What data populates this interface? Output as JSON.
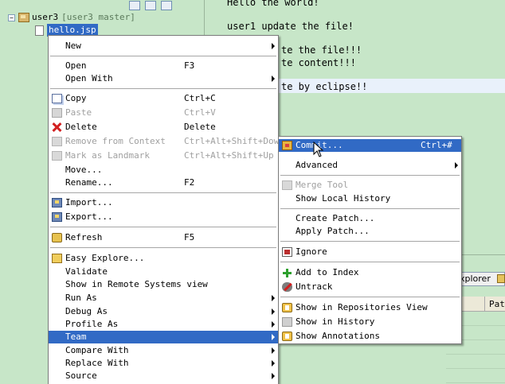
{
  "navigator": {
    "project_label": "user3",
    "project_decoration": "[user3 master]",
    "file_label": "hello.jsp",
    "collapse_glyph": "−"
  },
  "editor": {
    "lines": [
      "Hello the world!",
      "user1 update the file!",
      "te the file!!!",
      "te content!!!",
      "te by eclipse!!"
    ]
  },
  "bottom_view": {
    "tab_label": "xplorer",
    "column_header": "Path"
  },
  "context_menu": {
    "items": [
      {
        "label": "New"
      },
      {
        "label": "Open",
        "shortcut": "F3"
      },
      {
        "label": "Open With"
      },
      {
        "label": "Copy",
        "shortcut": "Ctrl+C",
        "icon": "copy-icon"
      },
      {
        "label": "Paste",
        "shortcut": "Ctrl+V",
        "icon": "paste-icon"
      },
      {
        "label": "Delete",
        "shortcut": "Delete",
        "icon": "delete-icon"
      },
      {
        "label": "Remove from Context",
        "shortcut": "Ctrl+Alt+Shift+Down",
        "icon": "remove-context-icon"
      },
      {
        "label": "Mark as Landmark",
        "shortcut": "Ctrl+Alt+Shift+Up",
        "icon": "landmark-icon"
      },
      {
        "label": "Move..."
      },
      {
        "label": "Rename...",
        "shortcut": "F2"
      },
      {
        "label": "Import...",
        "icon": "import-icon"
      },
      {
        "label": "Export...",
        "icon": "export-icon"
      },
      {
        "label": "Refresh",
        "shortcut": "F5",
        "icon": "refresh-icon"
      },
      {
        "label": "Easy Explore...",
        "icon": "folder-icon"
      },
      {
        "label": "Validate"
      },
      {
        "label": "Show in Remote Systems view"
      },
      {
        "label": "Run As"
      },
      {
        "label": "Debug As"
      },
      {
        "label": "Profile As"
      },
      {
        "label": "Team"
      },
      {
        "label": "Compare With"
      },
      {
        "label": "Replace With"
      },
      {
        "label": "Source"
      }
    ]
  },
  "team_menu": {
    "items": [
      {
        "label": "Commit...",
        "shortcut": "Ctrl+#",
        "icon": "commit-icon"
      },
      {
        "label": "Advanced"
      },
      {
        "label": "Merge Tool",
        "icon": "merge-tool-icon"
      },
      {
        "label": "Show Local History"
      },
      {
        "label": "Create Patch..."
      },
      {
        "label": "Apply Patch..."
      },
      {
        "label": "Ignore",
        "icon": "ignore-icon"
      },
      {
        "label": "Add to Index",
        "icon": "add-icon"
      },
      {
        "label": "Untrack",
        "icon": "untrack-icon"
      },
      {
        "label": "Show in Repositories View",
        "icon": "repositories-icon"
      },
      {
        "label": "Show in History",
        "icon": "history-icon"
      },
      {
        "label": "Show Annotations",
        "icon": "annotations-icon"
      }
    ]
  },
  "colors": {
    "background": "#c7e6c8",
    "selection": "#316ac5",
    "menu_background": "#ffffff",
    "disabled_text": "#a0a0a0",
    "line_highlight": "#e9f1fb"
  }
}
